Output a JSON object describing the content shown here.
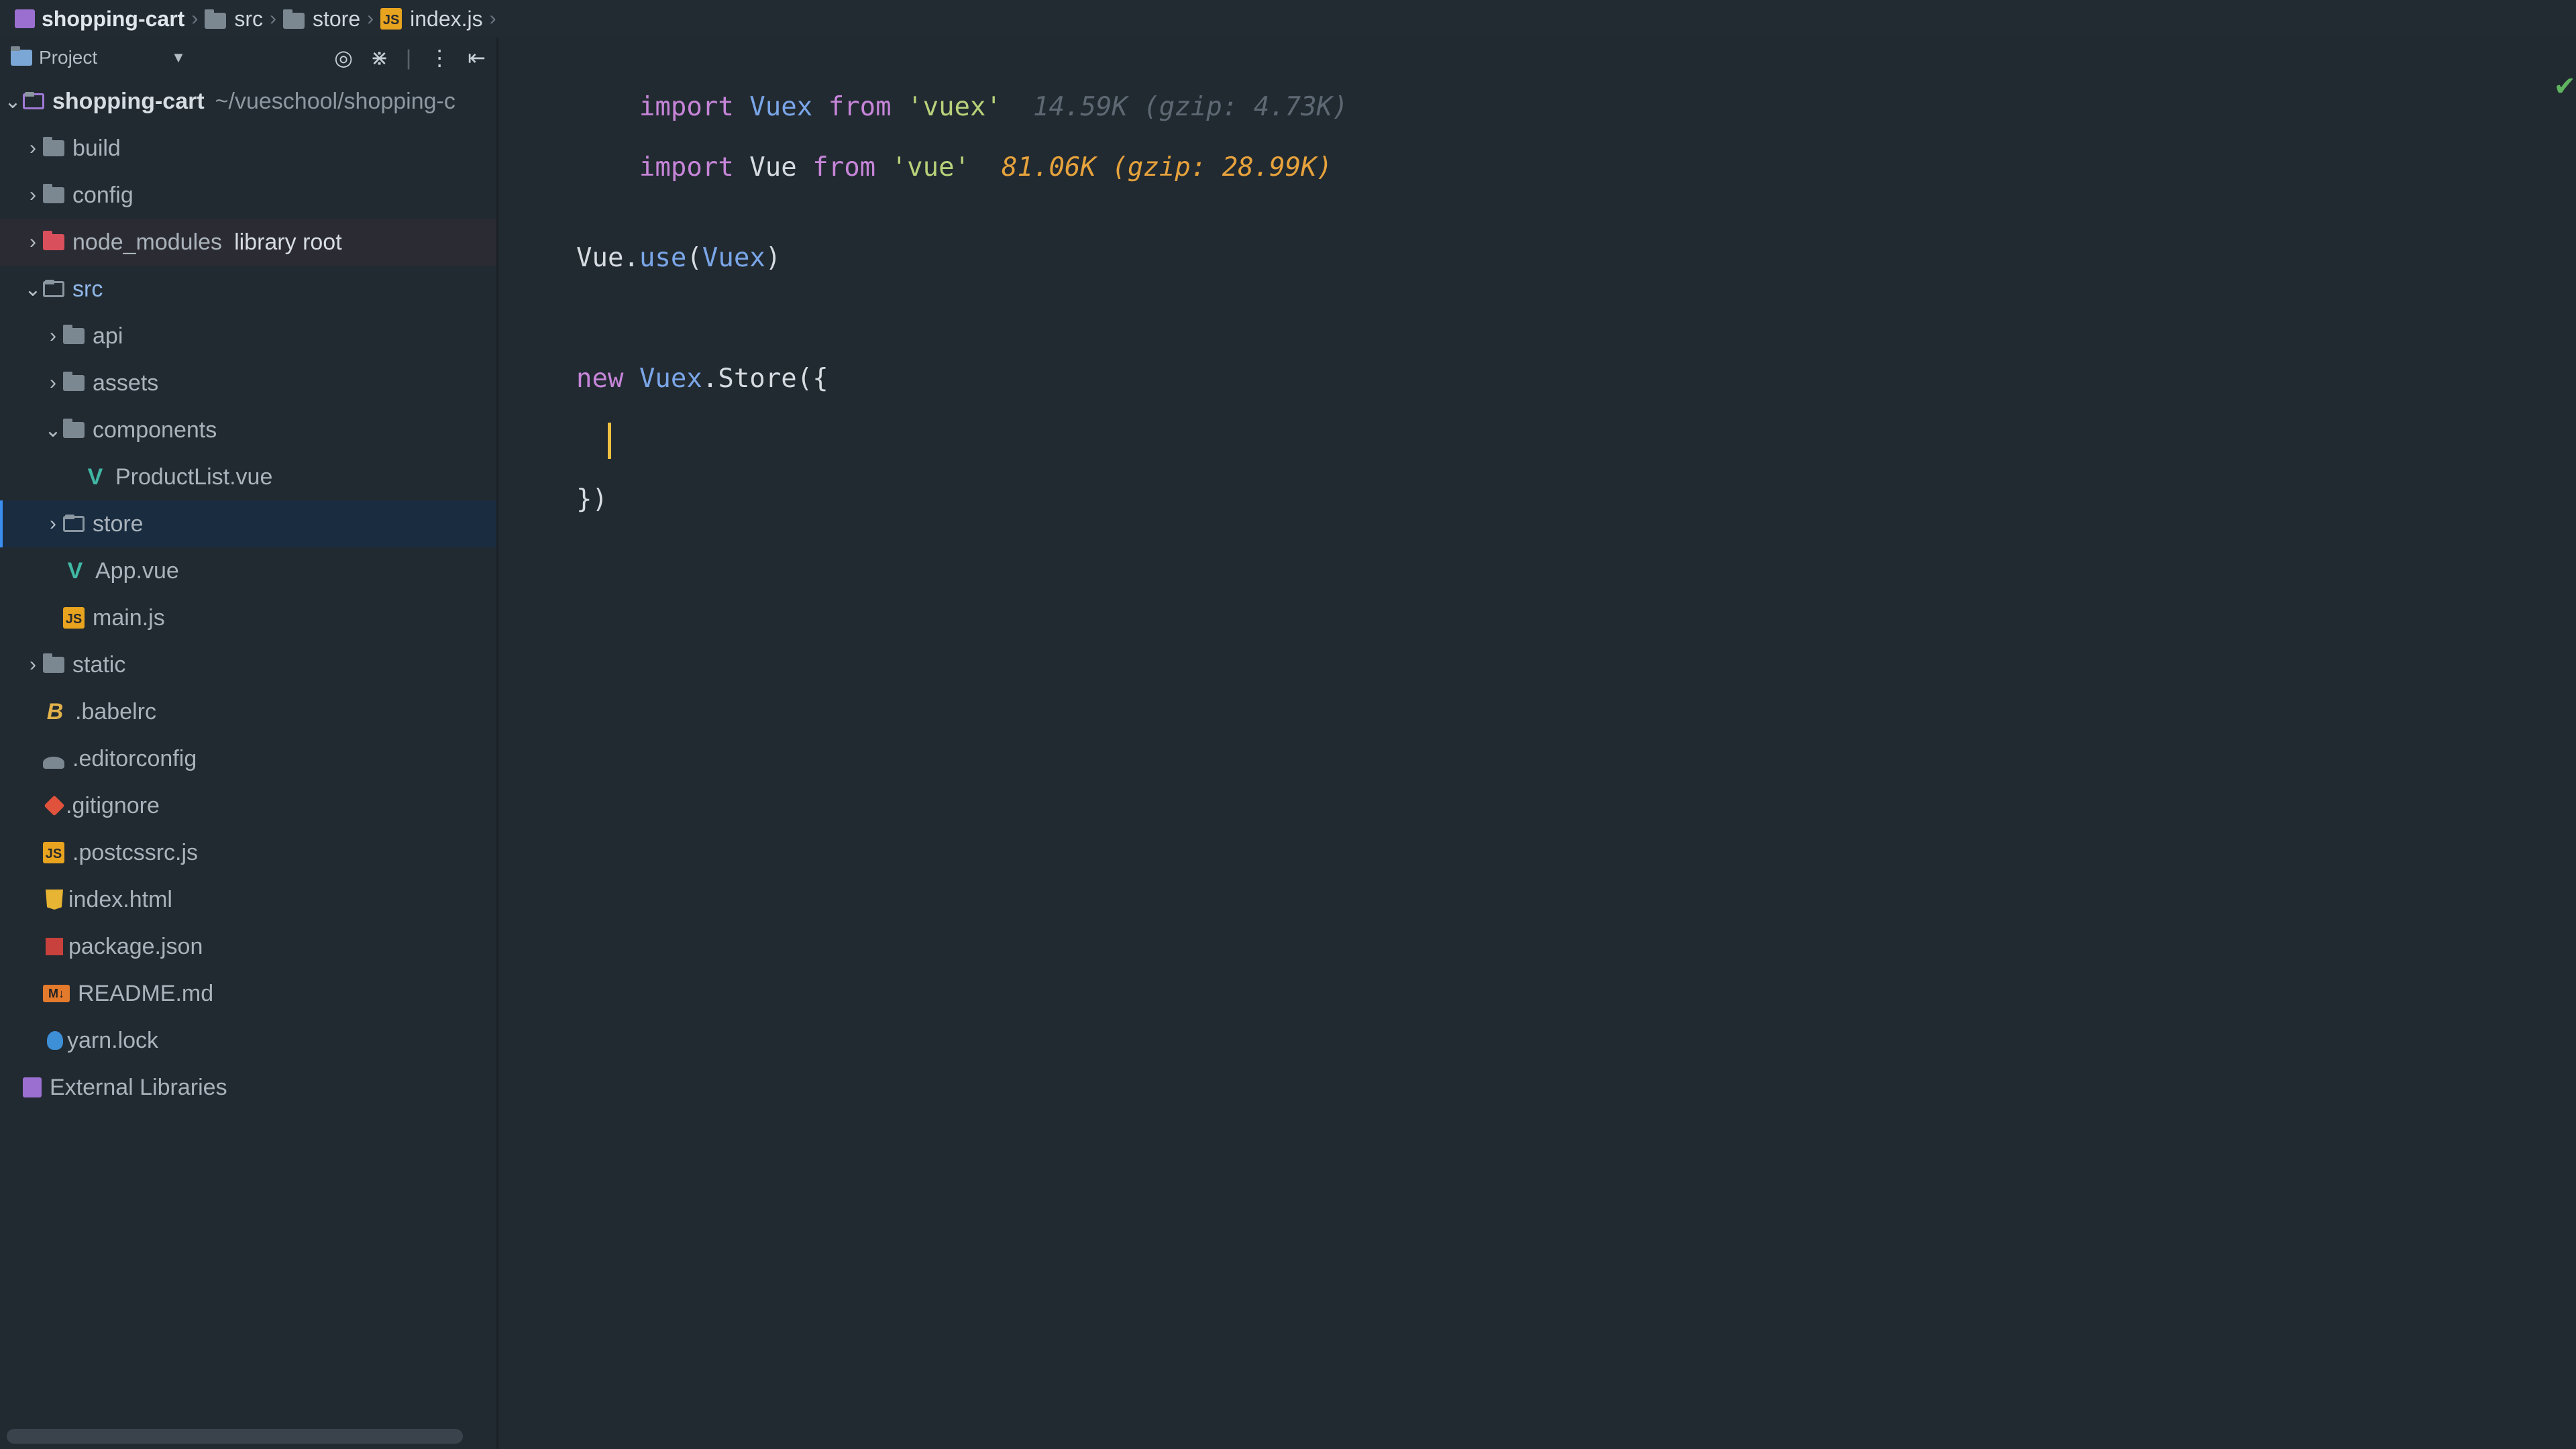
{
  "breadcrumb": [
    "shopping-cart",
    "src",
    "store",
    "index.js"
  ],
  "project_panel": {
    "title": "Project"
  },
  "tree": {
    "root_name": "shopping-cart",
    "root_path": "~/vueschool/shopping-c",
    "items": [
      {
        "label": "build"
      },
      {
        "label": "config"
      },
      {
        "label": "node_modules",
        "suffix": "library root"
      },
      {
        "label": "src"
      },
      {
        "label": "api"
      },
      {
        "label": "assets"
      },
      {
        "label": "components"
      },
      {
        "label": "ProductList.vue"
      },
      {
        "label": "store"
      },
      {
        "label": "App.vue"
      },
      {
        "label": "main.js"
      },
      {
        "label": "static"
      },
      {
        "label": ".babelrc"
      },
      {
        "label": ".editorconfig"
      },
      {
        "label": ".gitignore"
      },
      {
        "label": ".postcssrc.js"
      },
      {
        "label": "index.html"
      },
      {
        "label": "package.json"
      },
      {
        "label": "README.md"
      },
      {
        "label": "yarn.lock"
      },
      {
        "label": "External Libraries"
      }
    ]
  },
  "editor": {
    "line1": {
      "kw1": "import",
      "name": "Vuex",
      "kw2": "from",
      "str": "'vuex'",
      "hint": "14.59K (gzip: 4.73K)"
    },
    "line2": {
      "kw1": "import",
      "name": "Vue",
      "kw2": "from",
      "str": "'vue'",
      "hint": "81.06K (gzip: 28.99K)"
    },
    "line3": {
      "obj": "Vue",
      "dot": ".",
      "fn": "use",
      "open": "(",
      "arg": "Vuex",
      "close": ")"
    },
    "line4": {
      "kw": "new",
      "cls": "Vuex",
      "rest": ".Store({"
    },
    "line5": {
      "text": "})"
    }
  },
  "colors": {
    "accent": "#3a8ef0",
    "keyword": "#c685d8",
    "string": "#b7d27a",
    "hint": "#e6a23c"
  }
}
